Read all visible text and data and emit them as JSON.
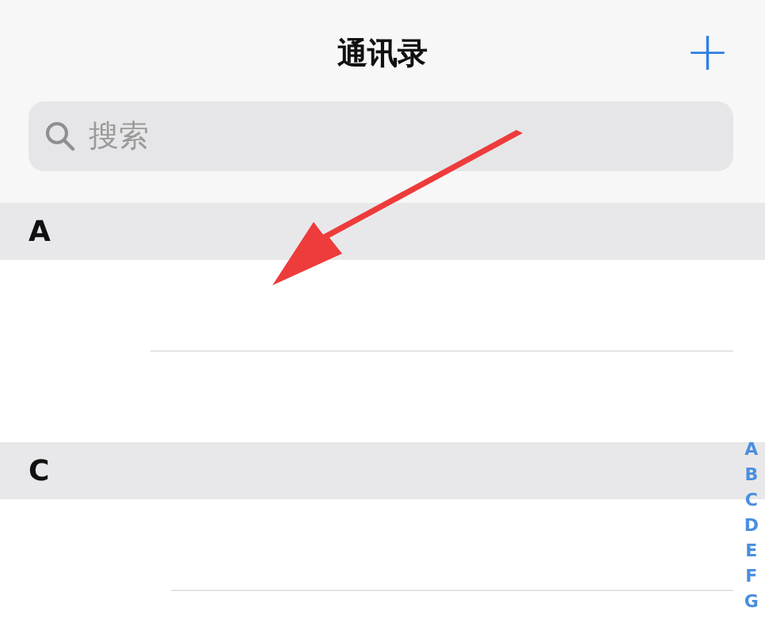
{
  "nav_bar": {
    "title": "通讯录",
    "add_button": "+"
  },
  "search": {
    "placeholder": "搜索"
  },
  "sections": [
    {
      "letter": "A"
    },
    {
      "letter": "C"
    }
  ],
  "index": [
    "A",
    "B",
    "C",
    "D",
    "E",
    "F",
    "G"
  ]
}
